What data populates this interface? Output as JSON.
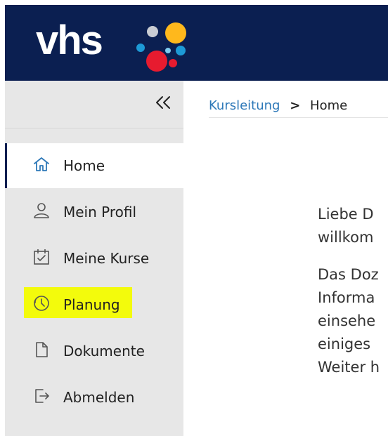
{
  "header": {
    "logo_text": "vhs",
    "colors": {
      "header_bg": "#0b1f51",
      "dot_red": "#e71b2f",
      "dot_yellow": "#ffb81c",
      "dot_blue": "#1d9ad6",
      "dot_lightblue": "#7ecbef",
      "dot_gray": "#c9ccd3"
    }
  },
  "sidebar": {
    "collapse_label": "«",
    "items": [
      {
        "label": "Home",
        "icon": "home-icon",
        "active": true
      },
      {
        "label": "Mein Profil",
        "icon": "user-icon",
        "active": false
      },
      {
        "label": "Meine Kurse",
        "icon": "calendar-check-icon",
        "active": false
      },
      {
        "label": "Planung",
        "icon": "clock-icon",
        "active": false,
        "highlighted": true
      },
      {
        "label": "Dokumente",
        "icon": "document-icon",
        "active": false
      },
      {
        "label": "Abmelden",
        "icon": "logout-icon",
        "active": false
      }
    ],
    "colors": {
      "background": "#e7e7e7",
      "active_background": "#ffffff",
      "active_border": "#0b1f51",
      "highlight": "#f3fb0c"
    }
  },
  "breadcrumb": {
    "parent": "Kursleitung",
    "separator": ">",
    "current": "Home"
  },
  "content": {
    "paragraphs": [
      [
        "Liebe D",
        "willkom"
      ],
      [
        "Das Doz",
        "Informa",
        "einsehe",
        "einiges",
        "Weiter h"
      ]
    ]
  }
}
